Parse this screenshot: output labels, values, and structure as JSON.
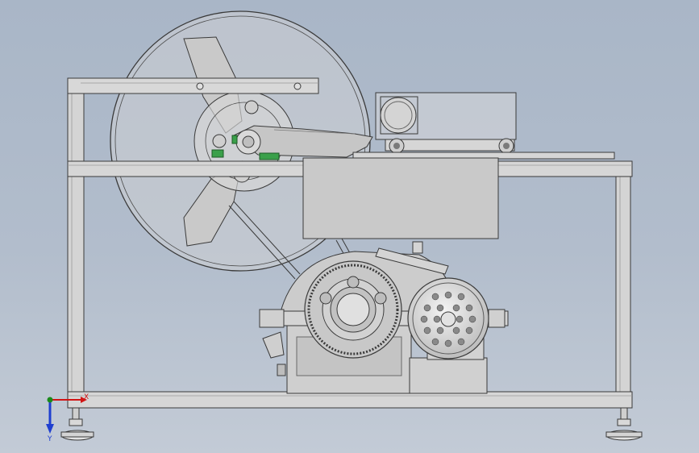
{
  "triad": {
    "x_label": "X",
    "y_label": "Y"
  },
  "colors": {
    "background_top": "#a9b6c7",
    "background_bottom": "#c3cbd6",
    "frame": "#d4d4d4",
    "outline": "#3a3a3a",
    "x_axis": "#d11414",
    "y_axis": "#1f3fd0",
    "z_axis": "#1a8a1a",
    "accent_green": "#3aa04a"
  },
  "icons": {
    "triad": "coordinate-triad-icon"
  }
}
